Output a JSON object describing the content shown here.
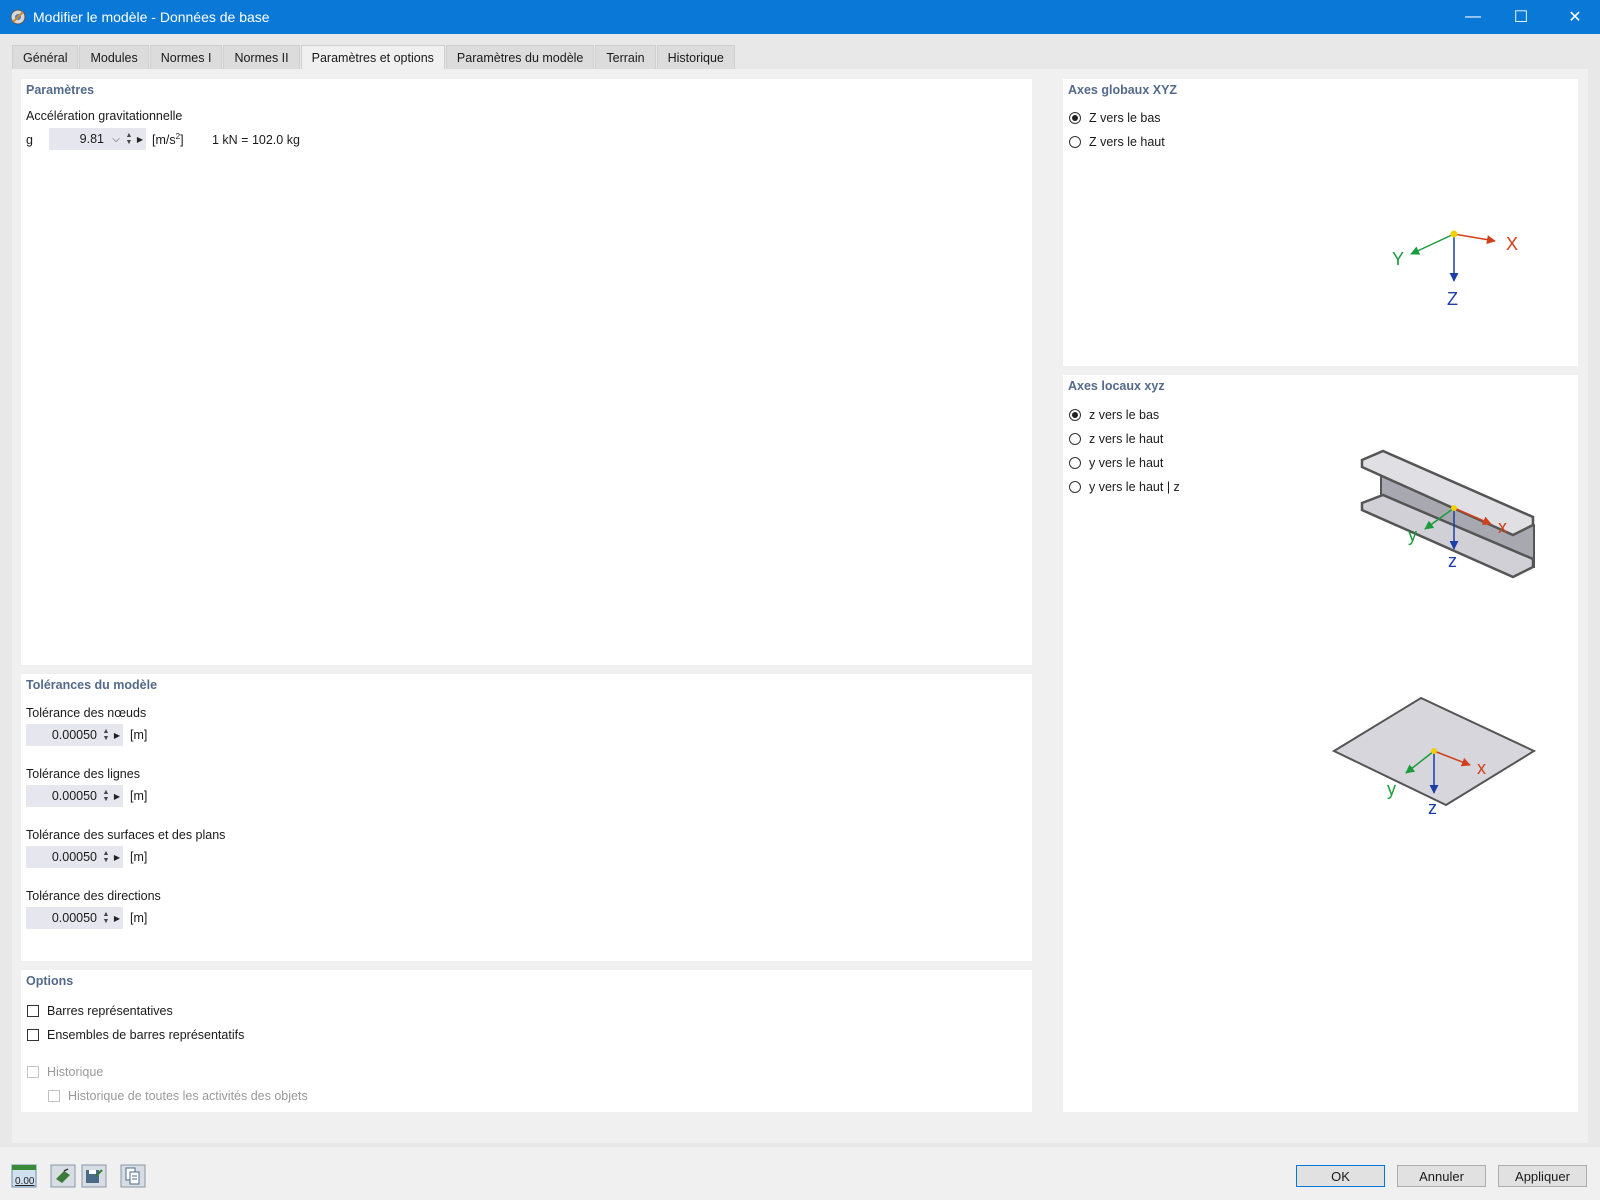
{
  "window": {
    "title": "Modifier le modèle - Données de base",
    "min_glyph": "—",
    "max_glyph": "☐",
    "close_glyph": "✕"
  },
  "tabs": [
    {
      "label": "Général",
      "active": false
    },
    {
      "label": "Modules",
      "active": false
    },
    {
      "label": "Normes I",
      "active": false
    },
    {
      "label": "Normes II",
      "active": false
    },
    {
      "label": "Paramètres et options",
      "active": true
    },
    {
      "label": "Paramètres du modèle",
      "active": false
    },
    {
      "label": "Terrain",
      "active": false
    },
    {
      "label": "Historique",
      "active": false
    }
  ],
  "parametres": {
    "title": "Paramètres",
    "gravity_label": "Accélération gravitationnelle",
    "g_symbol": "g",
    "g_value": "9.81",
    "g_unit_base": "[m/s",
    "g_unit_exp": "2",
    "g_unit_close": "]",
    "conversion": "1 kN = 102.0 kg"
  },
  "tolerances": {
    "title": "Tolérances du modèle",
    "items": [
      {
        "label": "Tolérance des nœuds",
        "value": "0.00050",
        "unit": "[m]"
      },
      {
        "label": "Tolérance des lignes",
        "value": "0.00050",
        "unit": "[m]"
      },
      {
        "label": "Tolérance des surfaces et des plans",
        "value": "0.00050",
        "unit": "[m]"
      },
      {
        "label": "Tolérance des directions",
        "value": "0.00050",
        "unit": "[m]"
      }
    ]
  },
  "options": {
    "title": "Options",
    "barres": "Barres représentatives",
    "ensembles": "Ensembles de barres représentatifs",
    "historique": "Historique",
    "historique_all": "Historique de toutes les activités des objets"
  },
  "axes_global": {
    "title": "Axes globaux XYZ",
    "options": [
      {
        "label": "Z vers le bas",
        "selected": true
      },
      {
        "label": "Z vers le haut",
        "selected": false
      }
    ],
    "axis_x": "X",
    "axis_y": "Y",
    "axis_z": "Z"
  },
  "axes_local": {
    "title": "Axes locaux xyz",
    "options": [
      {
        "label": "z vers le bas",
        "selected": true
      },
      {
        "label": "z vers le haut",
        "selected": false
      },
      {
        "label": "y vers le haut",
        "selected": false
      },
      {
        "label": "y vers le haut | z",
        "selected": false
      }
    ],
    "axis_x": "x",
    "axis_y": "y",
    "axis_z": "z"
  },
  "footer": {
    "units_icon_text": "0.00",
    "ok": "OK",
    "cancel": "Annuler",
    "apply": "Appliquer"
  },
  "colors": {
    "titlebar": "#0a78d7",
    "panel_title": "#546a8a",
    "axis_x": "#d0401a",
    "axis_y": "#1a9c3c",
    "axis_z": "#1a3fa8",
    "origin": "#f0d000"
  }
}
